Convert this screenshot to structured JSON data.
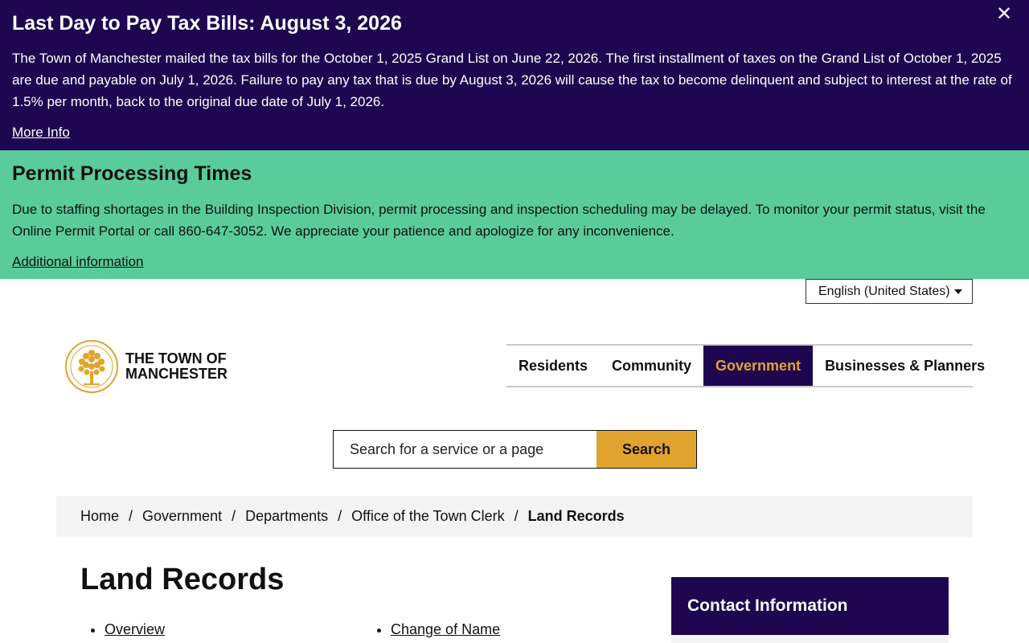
{
  "alerts": {
    "tax": {
      "title": "Last Day to Pay Tax Bills: August 3, 2026",
      "text": "The Town of Manchester mailed the tax bills for the October 1, 2025 Grand List on June 22, 2026. The first installment of taxes on the Grand List of October 1, 2025 are due and payable on July 1, 2026. Failure to pay any tax that is due by August 3, 2026 will cause the tax to become delinquent and subject to interest at the rate of 1.5% per month, back to the original due date of July 1, 2026.",
      "link": "More Info",
      "close_label": "✕"
    },
    "permit": {
      "title": "Permit Processing Times",
      "text": "Due to staffing shortages in the Building Inspection Division, permit processing and inspection scheduling may be delayed. To monitor your permit status, visit the Online Permit Portal or call 860-647-3052. We appreciate your patience and apologize for any inconvenience.",
      "link": "Additional information"
    }
  },
  "language": {
    "selected": "English (United States)"
  },
  "logo": {
    "line1": "THE TOWN OF",
    "line2": "MANCHESTER",
    "seal_icon": "tree-seal-icon"
  },
  "nav": {
    "items": [
      {
        "label": "Residents",
        "active": false
      },
      {
        "label": "Community",
        "active": false
      },
      {
        "label": "Government",
        "active": true
      },
      {
        "label": "Businesses & Planners",
        "active": false
      }
    ]
  },
  "search": {
    "placeholder": "Search for a service or a page",
    "button": "Search"
  },
  "breadcrumb": {
    "items": [
      "Home",
      "Government",
      "Departments",
      "Office of the Town Clerk"
    ],
    "current": "Land Records",
    "separator": "/"
  },
  "page": {
    "title": "Land Records",
    "links_left": [
      "Overview"
    ],
    "links_right": [
      "Change of Name"
    ]
  },
  "sidebar": {
    "contact_title": "Contact Information"
  },
  "colors": {
    "purple": "#1e0650",
    "green": "#5acc9c",
    "gold": "#e2a32e",
    "breadcrumb_bg": "#f3f3f3"
  }
}
